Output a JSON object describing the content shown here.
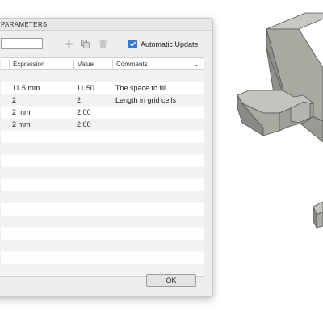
{
  "dialog": {
    "title": "PARAMETERS",
    "search_value": "",
    "auto_update_label": "Automatic Update",
    "auto_update_checked": true,
    "ok_label": "OK"
  },
  "table": {
    "columns": {
      "expression": "Expression",
      "value": "Value",
      "comments": "Comments"
    },
    "rows": [
      {
        "expression": "11.5 mm",
        "value": "11.50",
        "comment": "The space to fill"
      },
      {
        "expression": "2",
        "value": "2",
        "comment": "Length in grid cells"
      },
      {
        "expression": "2 mm",
        "value": "2.00",
        "comment": ""
      },
      {
        "expression": "2 mm",
        "value": "2.00",
        "comment": ""
      }
    ]
  },
  "colors": {
    "accent": "#2f77d8",
    "model_face": "#a9a9a2",
    "model_dark": "#7e7e79",
    "model_light": "#c9c9c3"
  }
}
